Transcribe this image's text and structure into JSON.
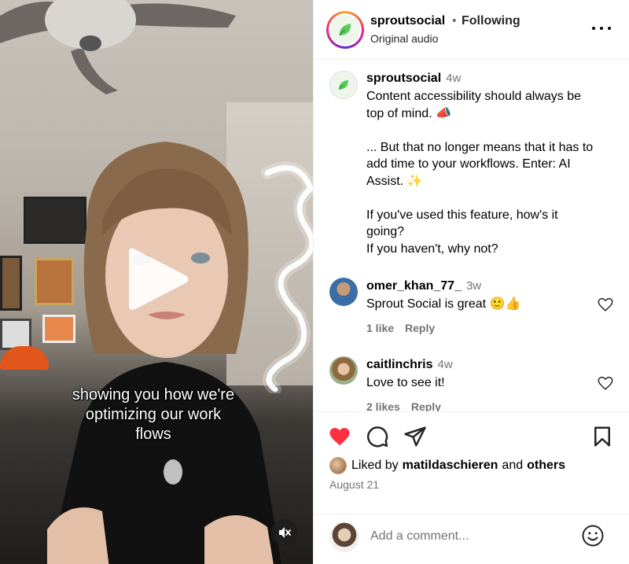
{
  "video": {
    "caption_lines": [
      "showing you how we're",
      "optimizing our work",
      "flows"
    ]
  },
  "header": {
    "username": "sproutsocial",
    "separator": "•",
    "follow_status": "Following",
    "audio": "Original audio"
  },
  "post": {
    "username": "sproutsocial",
    "time": "4w",
    "text_lines": [
      "Content accessibility should always be",
      "top of mind. 📣",
      "",
      "... But that no longer means that it has to",
      "add time to your workflows. Enter: AI",
      "Assist. ✨",
      "",
      "If you've used this feature, how's it",
      "going?",
      "If you haven't, why not?"
    ]
  },
  "comments": [
    {
      "username": "omer_khan_77_",
      "time": "3w",
      "text": "Sprout Social is great 🙂👍",
      "likes": "1 like",
      "reply": "Reply"
    },
    {
      "username": "caitlinchris",
      "time": "4w",
      "text": "Love to see it!",
      "likes": "2 likes",
      "reply": "Reply"
    }
  ],
  "actions": {
    "liked_by_prefix": "Liked by",
    "liked_by_user": "matildaschieren",
    "liked_by_and": "and",
    "liked_by_others": "others",
    "date": "August 21"
  },
  "add_comment": {
    "placeholder": "Add a comment..."
  },
  "colors": {
    "like_red": "#ff3040",
    "muted_text": "#737373",
    "brand_green": "#59cb59"
  },
  "icons": [
    "heart-icon",
    "comment-icon",
    "share-icon",
    "bookmark-icon",
    "more-icon",
    "emoji-icon",
    "mute-icon",
    "play-icon"
  ]
}
